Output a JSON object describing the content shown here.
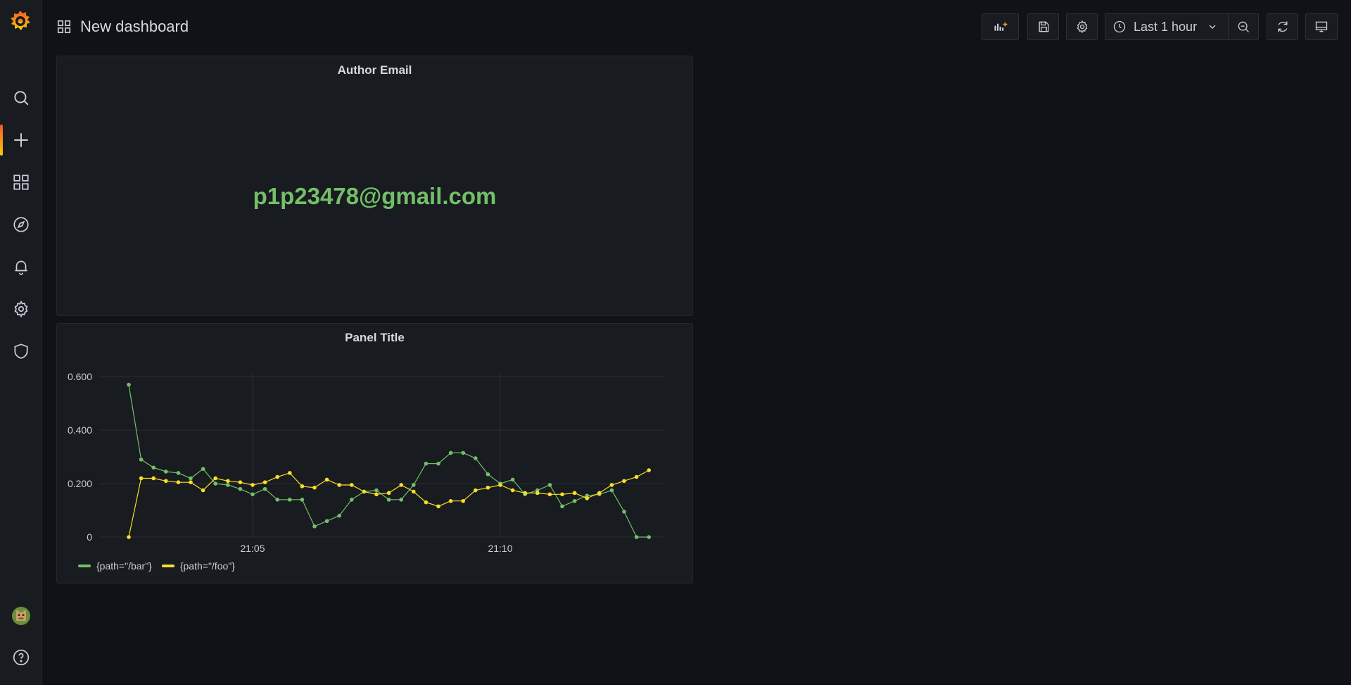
{
  "colors": {
    "accent": "#f05a28",
    "green": "#73bf69",
    "yellow": "#fade2a",
    "background": "#111217",
    "panel": "#181b1f"
  },
  "sidebar": {
    "logo": "grafana-logo",
    "items": [
      {
        "name": "search",
        "icon": "search-icon"
      },
      {
        "name": "create",
        "icon": "plus-icon",
        "active": true
      },
      {
        "name": "dashboards",
        "icon": "grid-icon"
      },
      {
        "name": "explore",
        "icon": "compass-icon"
      },
      {
        "name": "alerting",
        "icon": "bell-icon"
      },
      {
        "name": "configuration",
        "icon": "gear-icon"
      },
      {
        "name": "server-admin",
        "icon": "shield-icon"
      }
    ],
    "bottom": [
      {
        "name": "profile",
        "icon": "avatar"
      },
      {
        "name": "help",
        "icon": "help-icon"
      }
    ]
  },
  "header": {
    "title": "New dashboard",
    "buttons": [
      "add-panel-icon",
      "save-icon",
      "gear-icon",
      "zoom-out-icon",
      "refresh-icon",
      "tv-mode-icon"
    ],
    "time_range": "Last 1 hour"
  },
  "panels": {
    "stat": {
      "title": "Author Email",
      "value": "p1p23478@gmail.com"
    },
    "graph": {
      "title": "Panel Title"
    }
  },
  "chart_data": {
    "type": "line",
    "title": "Panel Title",
    "xlabel": "",
    "ylabel": "",
    "x_ticks": [
      "21:05",
      "21:10"
    ],
    "y_ticks": [
      "0",
      "0.200",
      "0.400",
      "0.600"
    ],
    "ylim": [
      0,
      0.64
    ],
    "grid": true,
    "legend_placement": "bottom-left",
    "x_minutes_first": "21:02.5",
    "x_minutes_step": 0.25,
    "series": [
      {
        "name": "{path=\"/bar\"}",
        "color": "#73bf69",
        "values": [
          0.57,
          0.29,
          0.26,
          0.245,
          0.24,
          0.22,
          0.255,
          0.2,
          0.195,
          0.18,
          0.16,
          0.18,
          0.14,
          0.14,
          0.14,
          0.04,
          0.06,
          0.08,
          0.14,
          0.17,
          0.175,
          0.14,
          0.14,
          0.195,
          0.275,
          0.275,
          0.315,
          0.315,
          0.295,
          0.235,
          0.2,
          0.215,
          0.16,
          0.175,
          0.195,
          0.115,
          0.135,
          0.155,
          0.16,
          0.175,
          0.095,
          0.0,
          0.0
        ]
      },
      {
        "name": "{path=\"/foo\"}",
        "color": "#fade2a",
        "values": [
          0.0,
          0.22,
          0.22,
          0.21,
          0.205,
          0.205,
          0.175,
          0.22,
          0.21,
          0.205,
          0.195,
          0.205,
          0.225,
          0.24,
          0.19,
          0.185,
          0.215,
          0.195,
          0.195,
          0.17,
          0.16,
          0.165,
          0.195,
          0.17,
          0.13,
          0.115,
          0.135,
          0.135,
          0.175,
          0.185,
          0.195,
          0.175,
          0.165,
          0.165,
          0.16,
          0.16,
          0.165,
          0.145,
          0.165,
          0.195,
          0.21,
          0.225,
          0.25
        ]
      }
    ]
  }
}
